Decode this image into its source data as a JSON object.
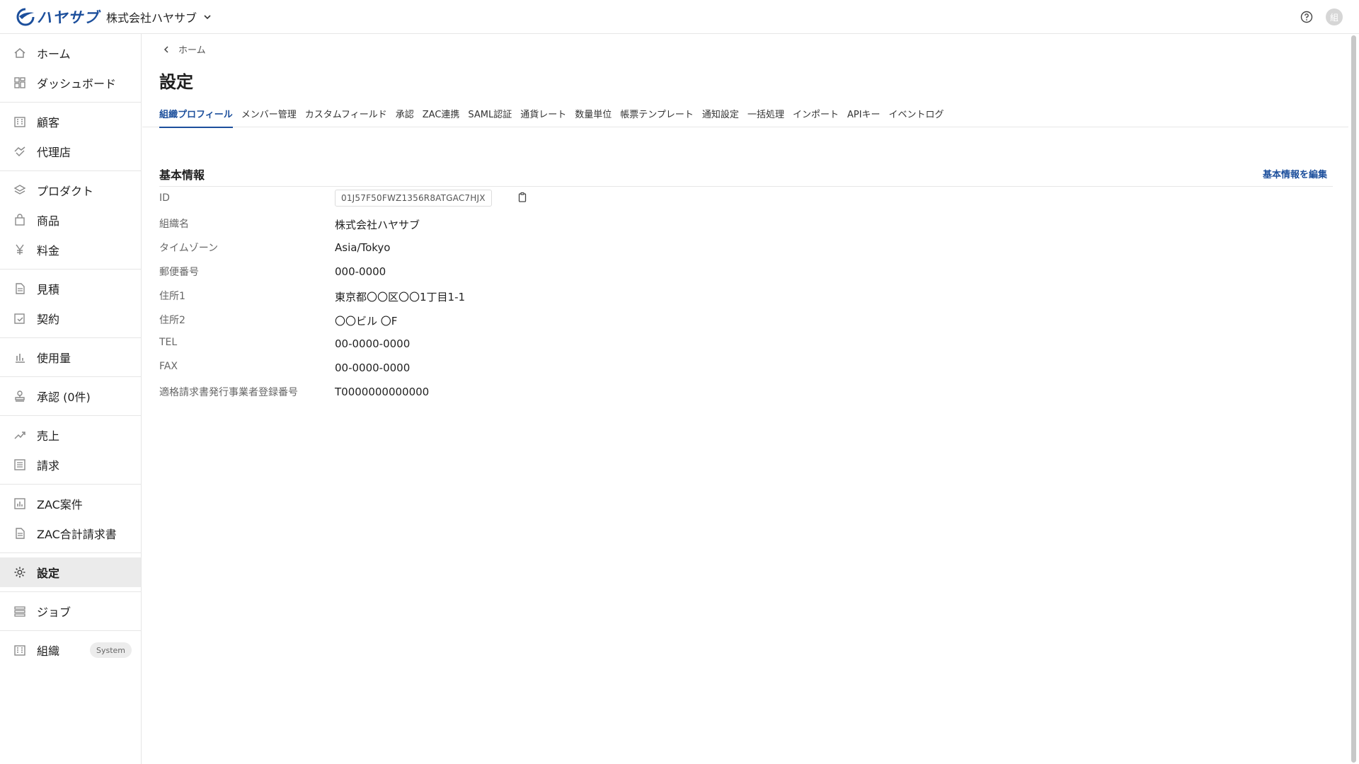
{
  "header": {
    "logo_text": "ハヤサブ",
    "org_name": "株式会社ハヤサブ",
    "avatar_text": "組",
    "brand_color": "#1c4f9c"
  },
  "sidebar": {
    "groups": [
      [
        {
          "label": "ホーム",
          "icon": "home-icon"
        },
        {
          "label": "ダッシュボード",
          "icon": "dashboard-icon"
        }
      ],
      [
        {
          "label": "顧客",
          "icon": "building-icon"
        },
        {
          "label": "代理店",
          "icon": "handshake-icon"
        }
      ],
      [
        {
          "label": "プロダクト",
          "icon": "layers-icon"
        },
        {
          "label": "商品",
          "icon": "bag-icon"
        },
        {
          "label": "料金",
          "icon": "yen-icon"
        }
      ],
      [
        {
          "label": "見積",
          "icon": "document-icon"
        },
        {
          "label": "契約",
          "icon": "calendar-check-icon"
        }
      ],
      [
        {
          "label": "使用量",
          "icon": "bar-chart-icon"
        }
      ],
      [
        {
          "label": "承認 (0件)",
          "icon": "stamp-icon"
        }
      ],
      [
        {
          "label": "売上",
          "icon": "trend-icon"
        },
        {
          "label": "請求",
          "icon": "list-icon"
        }
      ],
      [
        {
          "label": "ZAC案件",
          "icon": "chart-box-icon"
        },
        {
          "label": "ZAC合計請求書",
          "icon": "document-icon"
        }
      ],
      [
        {
          "label": "設定",
          "icon": "gear-icon",
          "active": true
        }
      ],
      [
        {
          "label": "ジョブ",
          "icon": "stack-icon"
        }
      ],
      [
        {
          "label": "組織",
          "icon": "building-icon",
          "badge": "System"
        }
      ]
    ]
  },
  "breadcrumb": {
    "label": "ホーム"
  },
  "page": {
    "title": "設定"
  },
  "tabs": [
    {
      "label": "組織プロフィール",
      "active": true
    },
    {
      "label": "メンバー管理"
    },
    {
      "label": "カスタムフィールド"
    },
    {
      "label": "承認"
    },
    {
      "label": "ZAC連携"
    },
    {
      "label": "SAML認証"
    },
    {
      "label": "通貨レート"
    },
    {
      "label": "数量単位"
    },
    {
      "label": "帳票テンプレート"
    },
    {
      "label": "通知設定"
    },
    {
      "label": "一括処理"
    },
    {
      "label": "インポート"
    },
    {
      "label": "APIキー"
    },
    {
      "label": "イベントログ"
    }
  ],
  "section": {
    "title": "基本情報",
    "edit_label": "基本情報を編集",
    "fields": [
      {
        "label": "ID",
        "value": "01J57F50FWZ1356R8ATGAC7HJX",
        "type": "id"
      },
      {
        "label": "組織名",
        "value": "株式会社ハヤサブ"
      },
      {
        "label": "タイムゾーン",
        "value": "Asia/Tokyo"
      },
      {
        "label": "郵便番号",
        "value": "000-0000"
      },
      {
        "label": "住所1",
        "value": "東京都〇〇区〇〇1丁目1-1"
      },
      {
        "label": "住所2",
        "value": "〇〇ビル 〇F"
      },
      {
        "label": "TEL",
        "value": "00-0000-0000"
      },
      {
        "label": "FAX",
        "value": "00-0000-0000"
      },
      {
        "label": "適格請求書発行事業者登録番号",
        "value": "T0000000000000"
      }
    ]
  }
}
